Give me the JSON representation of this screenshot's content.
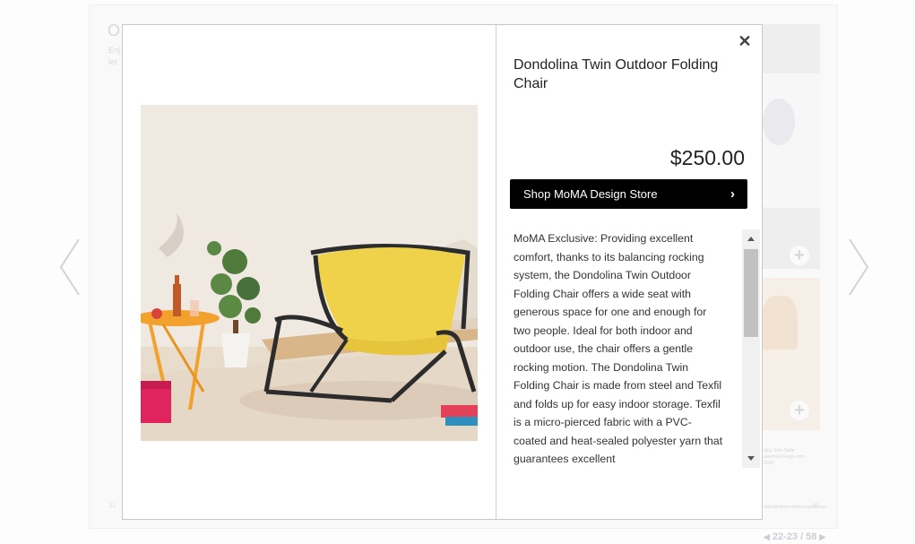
{
  "background": {
    "heading": "O",
    "sub_line_1": "Enj",
    "sub_line_2": "let",
    "caption_right": "ding Sofa Table\nasternal-Design.com\n2019",
    "footer_right_url": "adesignstore.moma.org/sh.com",
    "footer_right_num": "23",
    "footer_left_num": "22"
  },
  "navigation": {
    "prev_icon": "chevron-left-icon",
    "next_icon": "chevron-right-icon"
  },
  "pager": {
    "first_glyph": "◀",
    "current": "22-23",
    "separator": "/",
    "total": "58",
    "last_glyph": "▶"
  },
  "modal": {
    "close_glyph": "✕",
    "product_title": "Dondolina Twin Outdoor Folding Chair",
    "price": "$250.00",
    "shop_button_label": "Shop MoMA Design Store",
    "shop_button_icon": "chevron-right-icon",
    "description": "MoMA Exclusive: Providing excellent comfort, thanks to its balancing rocking system, the Dondolina Twin Outdoor Folding Chair offers a wide seat with generous space for one and enough for two people. Ideal for both indoor and outdoor use, the chair offers a gentle rocking motion. The Dondolina Twin Folding Chair is made from steel and Texfil and folds up for easy indoor storage. Texfil is a micro-pierced fabric with a PVC-coated and heat-sealed polyester yarn that guarantees excellent"
  },
  "colors": {
    "shop_button_bg": "#000000",
    "chair_seat": "#f0d24a",
    "chair_frame": "#2c2c2c",
    "table_orange": "#f2a22c",
    "cooler_pink": "#e0245e"
  }
}
